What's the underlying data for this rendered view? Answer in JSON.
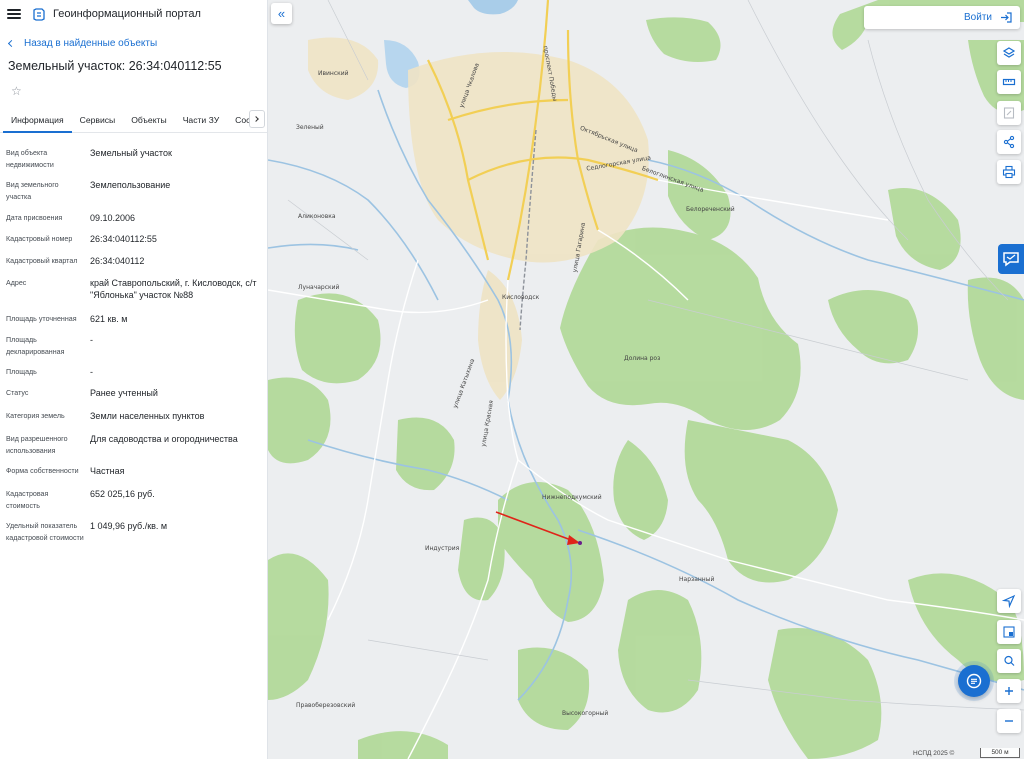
{
  "header": {
    "portal_name": "Геоинформационный портал"
  },
  "panel": {
    "back_label": "Назад в найденные объекты",
    "object_title": "Земельный участок: 26:34:040112:55",
    "tabs": [
      {
        "label": "Информация"
      },
      {
        "label": "Сервисы"
      },
      {
        "label": "Объекты"
      },
      {
        "label": "Части ЗУ"
      },
      {
        "label": "Состав"
      }
    ],
    "properties": [
      {
        "label": "Вид объекта недвижимости",
        "value": "Земельный участок"
      },
      {
        "label": "Вид земельного участка",
        "value": "Землепользование"
      },
      {
        "label": "Дата присвоения",
        "value": "09.10.2006"
      },
      {
        "label": "Кадастровый номер",
        "value": "26:34:040112:55"
      },
      {
        "label": "Кадастровый квартал",
        "value": "26:34:040112"
      },
      {
        "label": "Адрес",
        "value": "край Ставропольский, г. Кисловодск, с/т \"Яблонька\" участок №88"
      },
      {
        "label": "Площадь уточненная",
        "value": "621 кв. м"
      },
      {
        "label": "Площадь декларированная",
        "value": "-"
      },
      {
        "label": "Площадь",
        "value": "-"
      },
      {
        "label": "Статус",
        "value": "Ранее учтенный"
      },
      {
        "label": "Категория земель",
        "value": "Земли населенных пунктов"
      },
      {
        "label": "Вид разрешенного использования",
        "value": "Для садоводства и огородничества"
      },
      {
        "label": "Форма собственности",
        "value": "Частная"
      },
      {
        "label": "Кадастровая стоимость",
        "value": "652 025,16 руб."
      },
      {
        "label": "Удельный показатель кадастровой стоимости",
        "value": "1 049,96 руб./кв. м"
      }
    ]
  },
  "map": {
    "login_label": "Войти",
    "copyright": "НСПД 2025 ©",
    "scale": "500 м",
    "places": [
      {
        "name": "Кисловодск"
      },
      {
        "name": "Аликоновка"
      },
      {
        "name": "Луначарский"
      },
      {
        "name": "Белореченский"
      },
      {
        "name": "Долина роз"
      },
      {
        "name": "Нижнеподкумский"
      },
      {
        "name": "Индустрия"
      },
      {
        "name": "Нарзанный"
      },
      {
        "name": "Правоберезовский"
      },
      {
        "name": "Высокогорный"
      },
      {
        "name": "Ивинский"
      },
      {
        "name": "Зеленый"
      }
    ],
    "streets": [
      {
        "name": "Октябрьская улица"
      },
      {
        "name": "Седлогорская улица"
      },
      {
        "name": "Белоглинская улица"
      },
      {
        "name": "проспект Победы"
      },
      {
        "name": "улица Чкалова"
      },
      {
        "name": "улица Гагарина"
      },
      {
        "name": "улица Катыхина"
      },
      {
        "name": "улица Красная"
      }
    ]
  }
}
